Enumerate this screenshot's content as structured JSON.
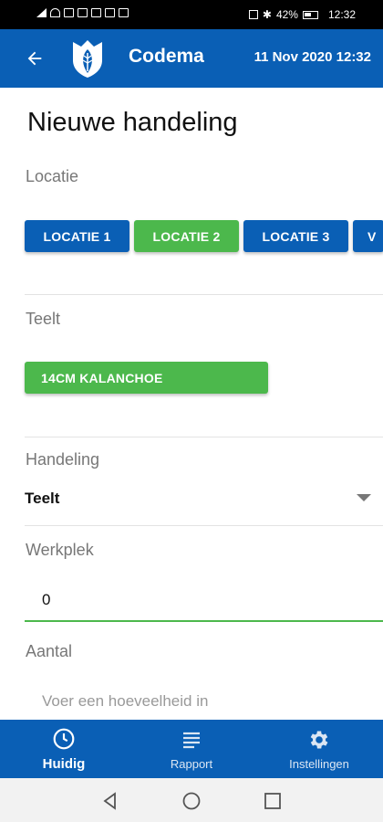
{
  "status_bar": {
    "battery_pct": "42%",
    "time": "12:32"
  },
  "app_bar": {
    "title": "Codema",
    "datetime": "11 Nov 2020 12:32",
    "back_icon": "arrow-left-icon",
    "logo_icon": "codema-logo-icon"
  },
  "page": {
    "title": "Nieuwe handeling"
  },
  "locatie": {
    "label": "Locatie",
    "chips": [
      {
        "label": "LOCATIE 1",
        "color": "#0a5fb5"
      },
      {
        "label": "LOCATIE 2",
        "color": "#4cb84c"
      },
      {
        "label": "LOCATIE 3",
        "color": "#0a5fb5"
      },
      {
        "label": "V",
        "color": "#0a5fb5"
      }
    ]
  },
  "teelt": {
    "label": "Teelt",
    "chips": [
      {
        "label": "14CM KALANCHOE",
        "color": "#4cb84c"
      }
    ]
  },
  "handeling": {
    "label": "Handeling",
    "value": "Teelt"
  },
  "werkplek": {
    "label": "Werkplek",
    "value": "0"
  },
  "aantal": {
    "label": "Aantal",
    "placeholder": "Voer een hoeveelheid in"
  },
  "bottom_nav": [
    {
      "label": "Huidig",
      "icon": "clock-icon",
      "active": true
    },
    {
      "label": "Rapport",
      "icon": "list-icon",
      "active": false
    },
    {
      "label": "Instellingen",
      "icon": "gear-icon",
      "active": false
    }
  ],
  "colors": {
    "primary": "#0a5fb5",
    "accent": "#4cb84c"
  }
}
